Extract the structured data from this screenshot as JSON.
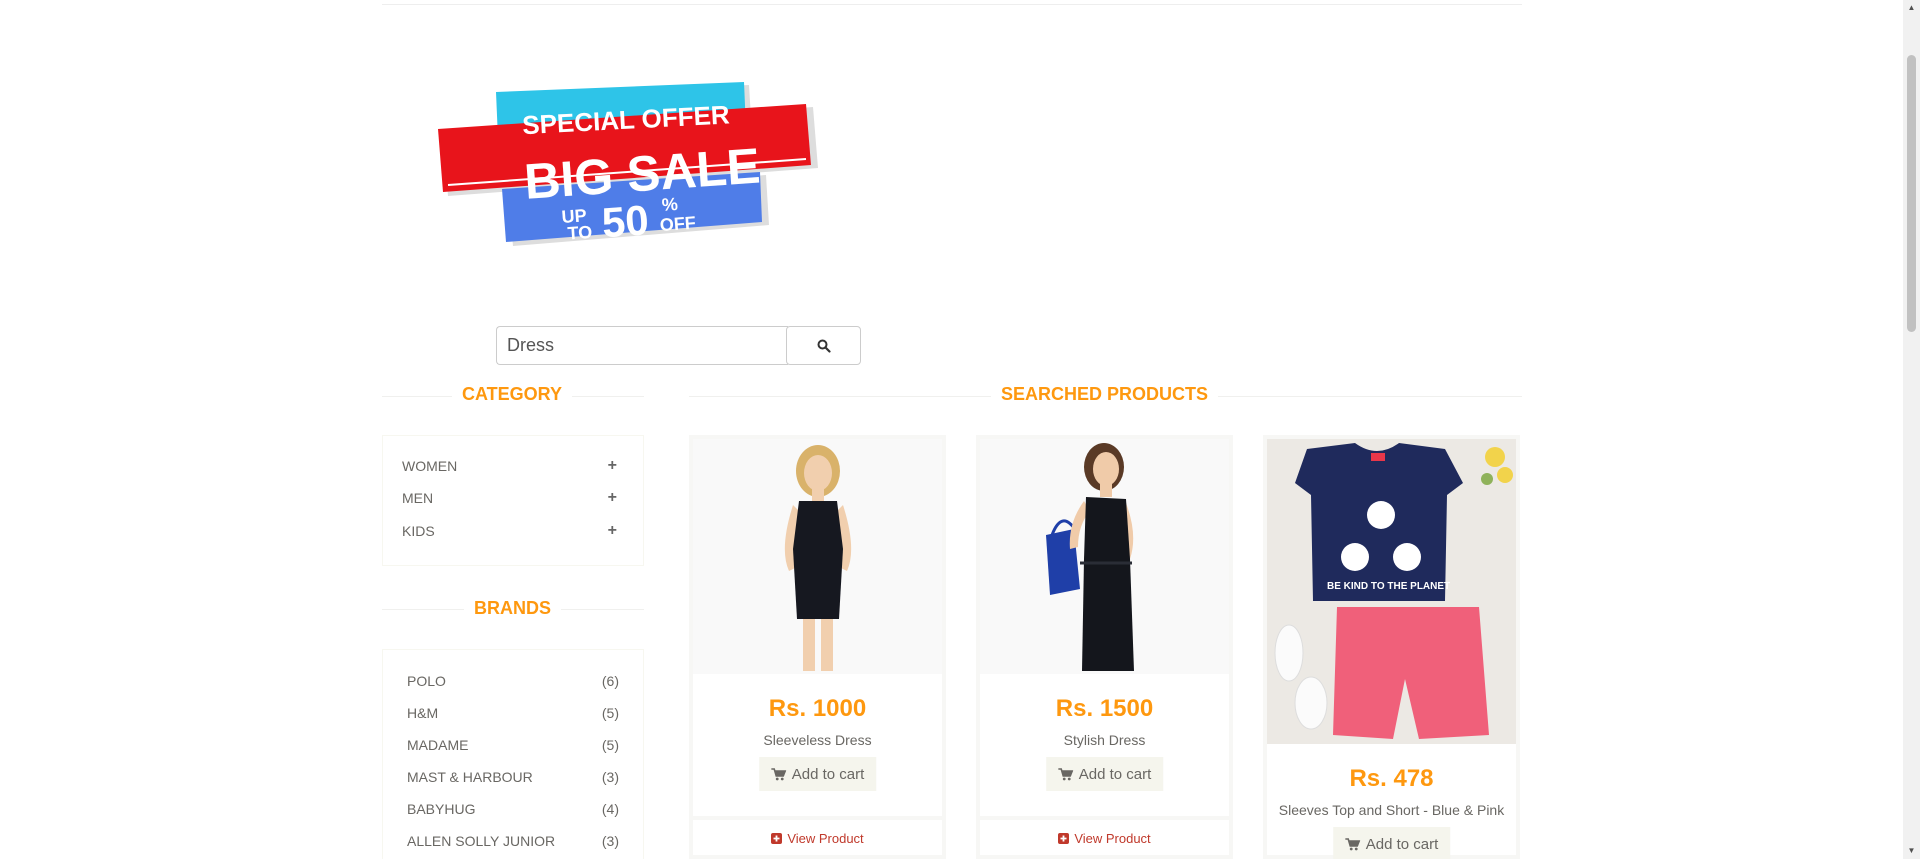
{
  "banner": {
    "line1": "SPECIAL OFFER",
    "line2": "BIG SALE",
    "up": "UP",
    "to": "TO",
    "percent": "50",
    "pct_sign": "%",
    "off": "OFF"
  },
  "search": {
    "value": "Dress",
    "icon": "search-icon"
  },
  "sidebar": {
    "category_title": "Category",
    "categories": [
      {
        "label": "WOMEN",
        "icon": "plus-icon"
      },
      {
        "label": "MEN",
        "icon": "plus-icon"
      },
      {
        "label": "KIDS",
        "icon": "plus-icon"
      }
    ],
    "brands_title": "Brands",
    "brands": [
      {
        "label": "POLO",
        "count": "(6)"
      },
      {
        "label": "H&M",
        "count": "(5)"
      },
      {
        "label": "MADAME",
        "count": "(5)"
      },
      {
        "label": "MAST & HARBOUR",
        "count": "(3)"
      },
      {
        "label": "BABYHUG",
        "count": "(4)"
      },
      {
        "label": "ALLEN SOLLY JUNIOR",
        "count": "(3)"
      }
    ]
  },
  "main": {
    "title": "Searched Products",
    "products": [
      {
        "price": "Rs. 1000",
        "name": "Sleeveless Dress",
        "add_to_cart": "Add to cart",
        "view": "View Product"
      },
      {
        "price": "Rs. 1500",
        "name": "Stylish Dress",
        "add_to_cart": "Add to cart",
        "view": "View Product"
      },
      {
        "price": "Rs. 478",
        "name": "Sleeves Top and Short - Blue & Pink",
        "add_to_cart": "Add to cart"
      }
    ]
  },
  "colors": {
    "accent": "#FE980F",
    "text": "#696763",
    "cart_bg": "#F5F5ED",
    "banner_red": "#E8141B",
    "banner_cyan": "#2EC4E8",
    "banner_blue": "#4F7DE8"
  }
}
